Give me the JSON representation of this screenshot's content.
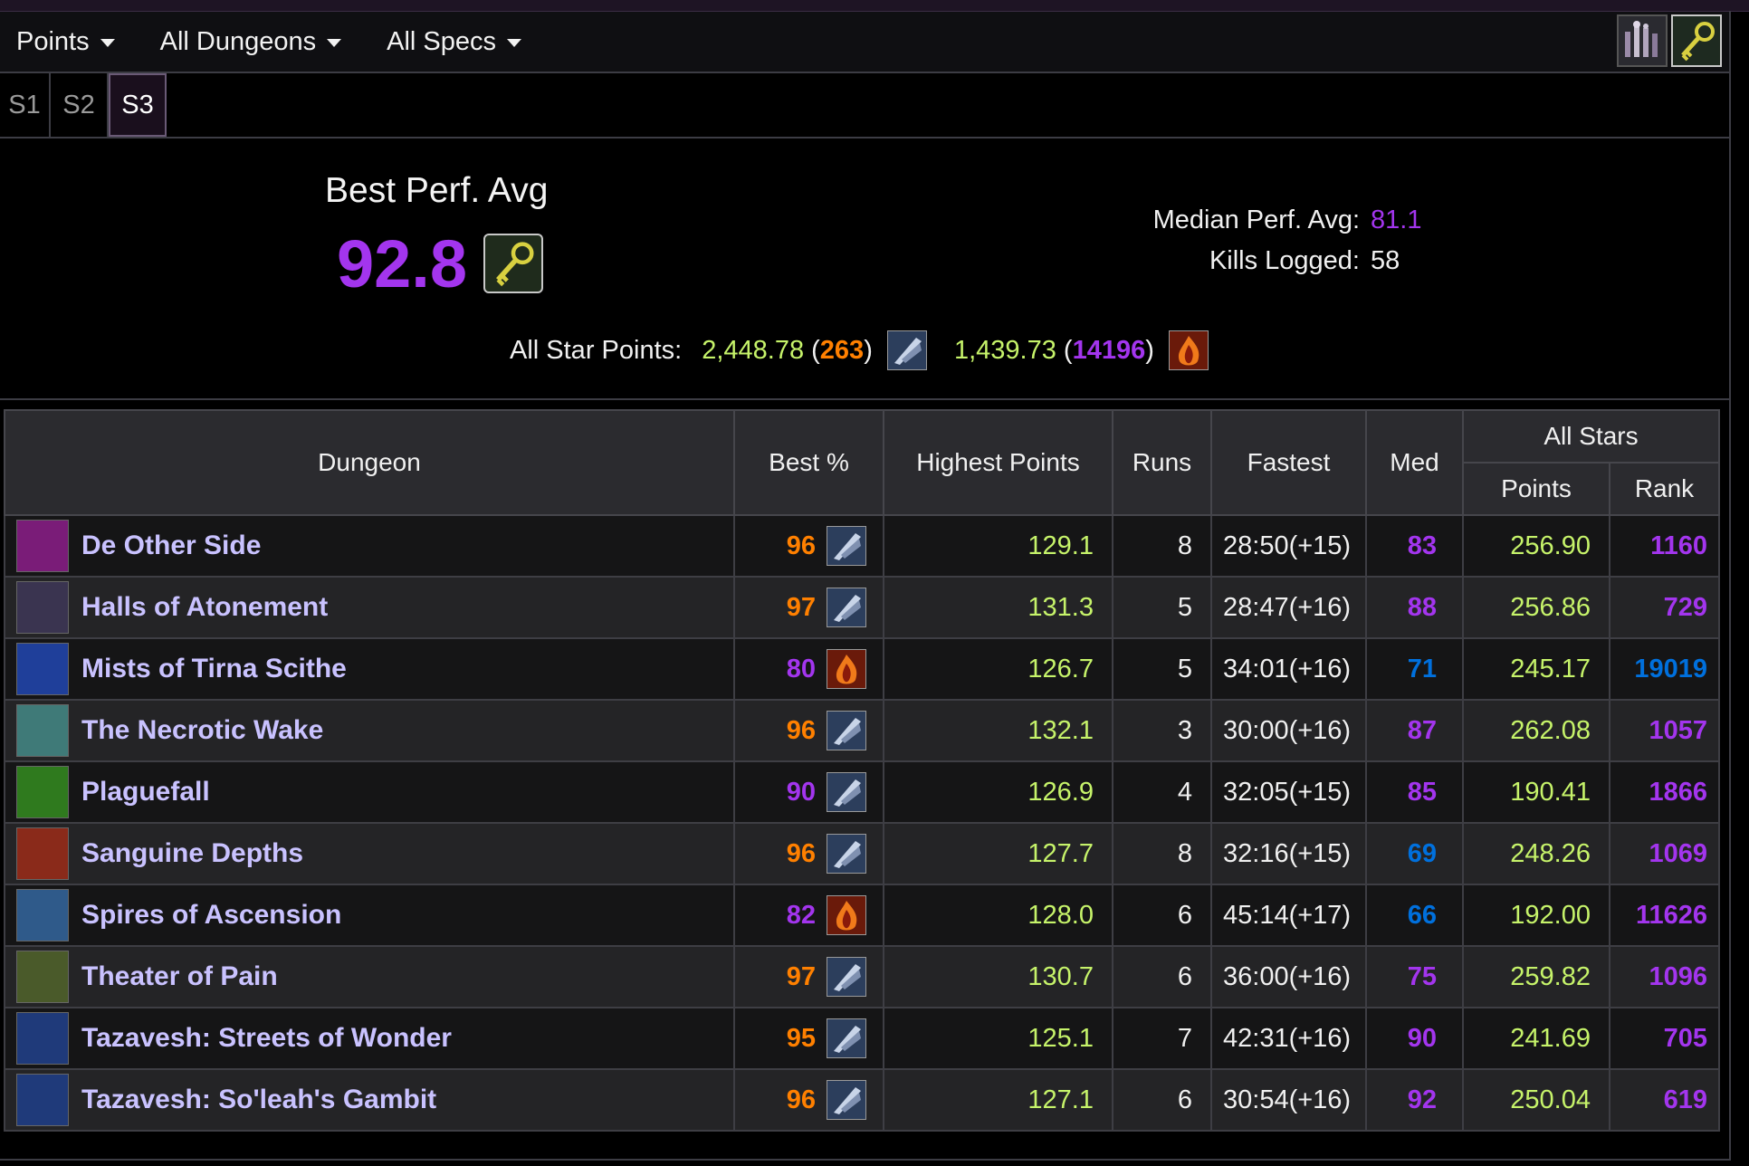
{
  "menu": {
    "items": [
      {
        "label": "Points"
      },
      {
        "label": "All Dungeons"
      },
      {
        "label": "All Specs"
      }
    ],
    "icons": [
      "character-spec-icon",
      "mythic-keystone-icon"
    ]
  },
  "seasons": [
    "S1",
    "S2",
    "S3"
  ],
  "active_season": "S3",
  "summary": {
    "best_title": "Best Perf. Avg",
    "best_value": "92.8",
    "median_label": "Median Perf. Avg:",
    "median_value": "81.1",
    "kills_label": "Kills Logged:",
    "kills_value": "58",
    "allstar_label": "All Star Points:",
    "spec1_points": "2,448.78",
    "spec1_rank": "263",
    "spec2_points": "1,439.73",
    "spec2_rank": "14196"
  },
  "table": {
    "headers": {
      "dungeon": "Dungeon",
      "best": "Best %",
      "highest": "Highest Points",
      "runs": "Runs",
      "fastest": "Fastest",
      "med": "Med",
      "allstars": "All Stars",
      "points": "Points",
      "rank": "Rank"
    },
    "rows": [
      {
        "name": "De Other Side",
        "best": "96",
        "best_color": "#ff8000",
        "spec": "blade",
        "highest": "129.1",
        "runs": "8",
        "fastest": "28:50(+15)",
        "med": "83",
        "med_color": "#a335ee",
        "points": "256.90",
        "rank": "1160",
        "rank_color": "#a335ee",
        "icon_color": "#7a1c78"
      },
      {
        "name": "Halls of Atonement",
        "best": "97",
        "best_color": "#ff8000",
        "spec": "blade",
        "highest": "131.3",
        "runs": "5",
        "fastest": "28:47(+16)",
        "med": "88",
        "med_color": "#a335ee",
        "points": "256.86",
        "rank": "729",
        "rank_color": "#a335ee",
        "icon_color": "#3a3450"
      },
      {
        "name": "Mists of Tirna Scithe",
        "best": "80",
        "best_color": "#a335ee",
        "spec": "fire",
        "highest": "126.7",
        "runs": "5",
        "fastest": "34:01(+16)",
        "med": "71",
        "med_color": "#0070dd",
        "points": "245.17",
        "rank": "19019",
        "rank_color": "#0070dd",
        "icon_color": "#1f3f9a"
      },
      {
        "name": "The Necrotic Wake",
        "best": "96",
        "best_color": "#ff8000",
        "spec": "blade",
        "highest": "132.1",
        "runs": "3",
        "fastest": "30:00(+16)",
        "med": "87",
        "med_color": "#a335ee",
        "points": "262.08",
        "rank": "1057",
        "rank_color": "#a335ee",
        "icon_color": "#3f7a78"
      },
      {
        "name": "Plaguefall",
        "best": "90",
        "best_color": "#a335ee",
        "spec": "blade",
        "highest": "126.9",
        "runs": "4",
        "fastest": "32:05(+15)",
        "med": "85",
        "med_color": "#a335ee",
        "points": "190.41",
        "rank": "1866",
        "rank_color": "#a335ee",
        "icon_color": "#2f7a1e"
      },
      {
        "name": "Sanguine Depths",
        "best": "96",
        "best_color": "#ff8000",
        "spec": "blade",
        "highest": "127.7",
        "runs": "8",
        "fastest": "32:16(+15)",
        "med": "69",
        "med_color": "#0070dd",
        "points": "248.26",
        "rank": "1069",
        "rank_color": "#a335ee",
        "icon_color": "#8a2a1a"
      },
      {
        "name": "Spires of Ascension",
        "best": "82",
        "best_color": "#a335ee",
        "spec": "fire",
        "highest": "128.0",
        "runs": "6",
        "fastest": "45:14(+17)",
        "med": "66",
        "med_color": "#0070dd",
        "points": "192.00",
        "rank": "11626",
        "rank_color": "#a335ee",
        "icon_color": "#2f5a8a"
      },
      {
        "name": "Theater of Pain",
        "best": "97",
        "best_color": "#ff8000",
        "spec": "blade",
        "highest": "130.7",
        "runs": "6",
        "fastest": "36:00(+16)",
        "med": "75",
        "med_color": "#a335ee",
        "points": "259.82",
        "rank": "1096",
        "rank_color": "#a335ee",
        "icon_color": "#4a5a2a"
      },
      {
        "name": "Tazavesh: Streets of Wonder",
        "best": "95",
        "best_color": "#ff8000",
        "spec": "blade",
        "highest": "125.1",
        "runs": "7",
        "fastest": "42:31(+16)",
        "med": "90",
        "med_color": "#a335ee",
        "points": "241.69",
        "rank": "705",
        "rank_color": "#a335ee",
        "icon_color": "#1f3a7a"
      },
      {
        "name": "Tazavesh: So'leah's Gambit",
        "best": "96",
        "best_color": "#ff8000",
        "spec": "blade",
        "highest": "127.1",
        "runs": "6",
        "fastest": "30:54(+16)",
        "med": "92",
        "med_color": "#a335ee",
        "points": "250.04",
        "rank": "619",
        "rank_color": "#a335ee",
        "icon_color": "#1f3a7a"
      }
    ]
  }
}
